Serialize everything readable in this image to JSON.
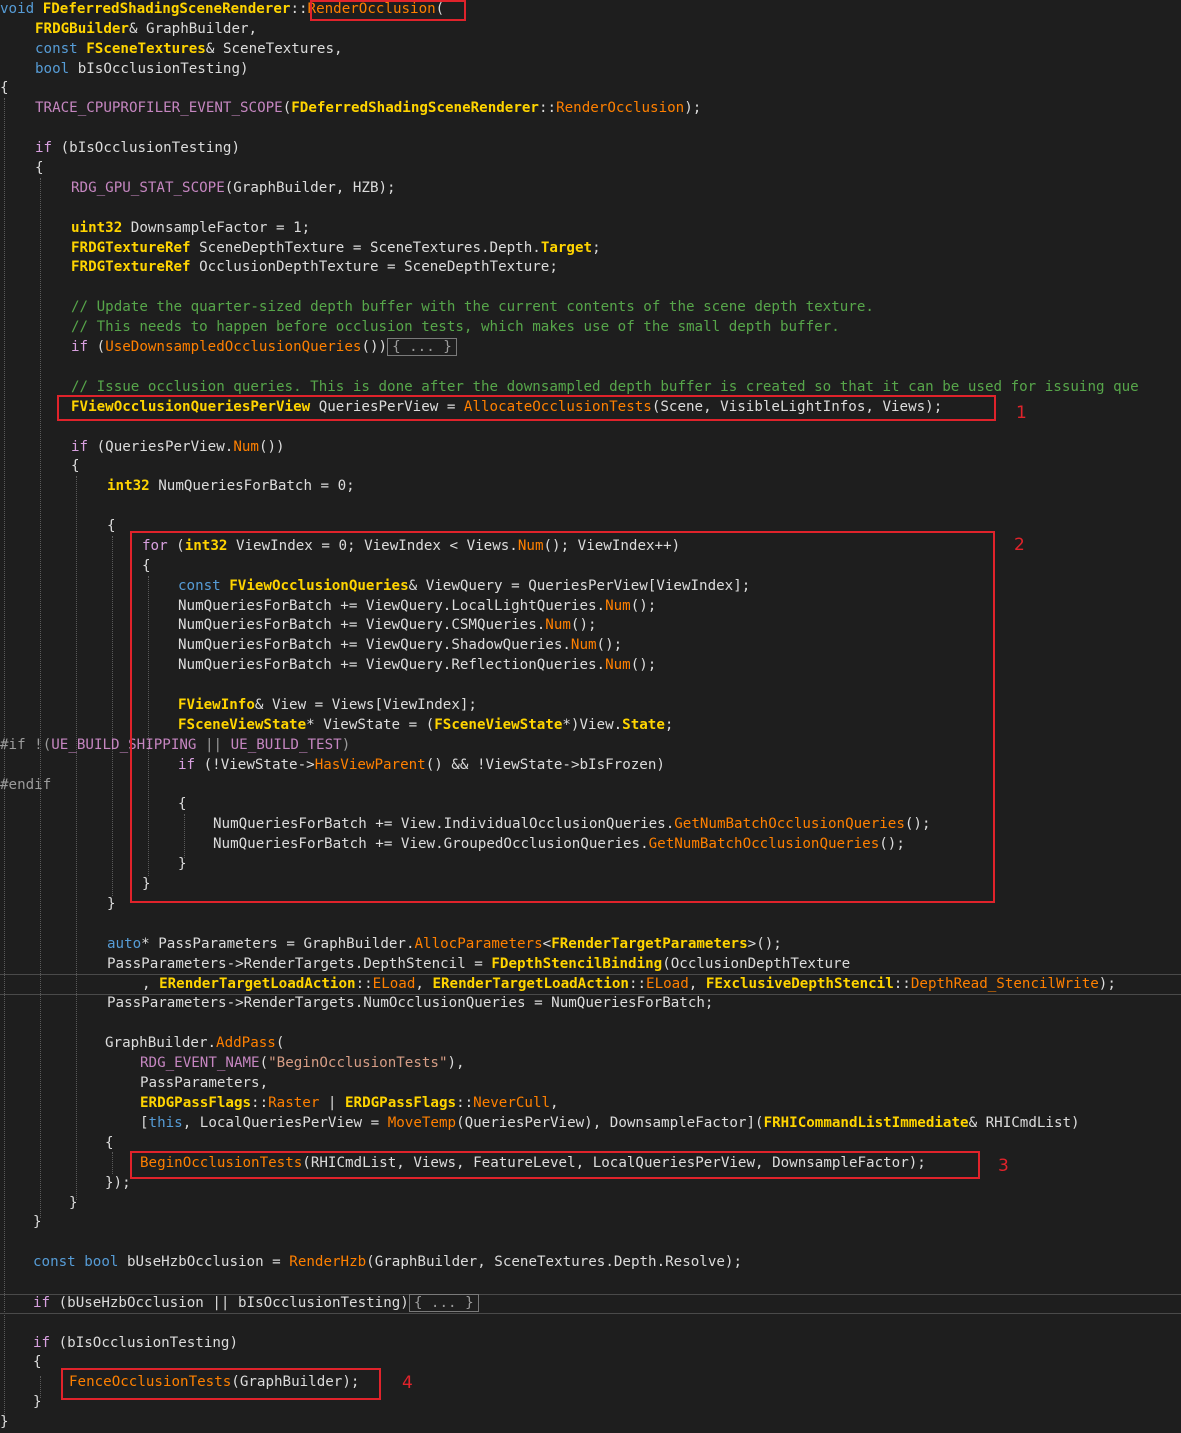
{
  "code": {
    "sig_void": "void",
    "sig_class": "FDeferredShadingSceneRenderer",
    "sig_sep": "::",
    "sig_fn": "RenderOcclusion",
    "sig_paren": "(",
    "p1_type": "FRDGBuilder",
    "p1_rest": "& GraphBuilder,",
    "p2_const": "const",
    "p2_type": "FSceneTextures",
    "p2_rest": "& SceneTextures,",
    "p3_bool": "bool",
    "p3_rest": " bIsOcclusionTesting)",
    "brace_open": "{",
    "trace_macro": "TRACE_CPUPROFILER_EVENT_SCOPE",
    "trace_open": "(",
    "trace_class": "FDeferredShadingSceneRenderer",
    "trace_sep": "::",
    "trace_fn": "RenderOcclusion",
    "trace_close": ");",
    "if1_kw": "if",
    "if1_rest": " (bIsOcclusionTesting)",
    "gpu_macro": "RDG_GPU_STAT_SCOPE",
    "gpu_rest": "(GraphBuilder, HZB);",
    "ds_type": "uint32",
    "ds_rest": " DownsampleFactor = 1;",
    "sdt_type": "FRDGTextureRef",
    "sdt_a": " SceneDepthTexture = SceneTextures.Depth.",
    "sdt_target": "Target",
    "sdt_end": ";",
    "odt_type": "FRDGTextureRef",
    "odt_rest": " OcclusionDepthTexture = SceneDepthTexture;",
    "comment1": "// Update the quarter-sized depth buffer with the current contents of the scene depth texture.",
    "comment2": "// This needs to happen before occlusion tests, which makes use of the small depth buffer.",
    "if2_kw": "if",
    "if2_a": " (",
    "if2_fn": "UseDownsampledOcclusionQueries",
    "if2_b": "())",
    "fold1": "{ ... }",
    "comment3": "// Issue occlusion queries. This is done after the downsampled depth buffer is created so that it can be used for issuing que",
    "qpv_type": "FViewOcclusionQueriesPerView",
    "qpv_a": " QueriesPerView = ",
    "qpv_fn": "AllocateOcclusionTests",
    "qpv_b": "(Scene, VisibleLightInfos, Views);",
    "if3_kw": "if",
    "if3_a": " (QueriesPerView.",
    "if3_num": "Num",
    "if3_b": "())",
    "nq_type": "int32",
    "nq_rest": " NumQueriesForBatch = 0;",
    "for_kw": "for",
    "for_a": " (",
    "for_type": "int32",
    "for_b": " ViewIndex = 0; ViewIndex < Views.",
    "for_num": "Num",
    "for_c": "(); ViewIndex++)",
    "vq_const": "const",
    "vq_type": "FViewOcclusionQueries",
    "vq_rest": "& ViewQuery = QueriesPerView[ViewIndex];",
    "l1_a": "NumQueriesForBatch += ViewQuery.LocalLightQueries.",
    "l2_a": "NumQueriesForBatch += ViewQuery.CSMQueries.",
    "l3_a": "NumQueriesForBatch += ViewQuery.ShadowQueries.",
    "l4_a": "NumQueriesForBatch += ViewQuery.ReflectionQueries.",
    "num_fn": "Num",
    "num_end": "();",
    "vi_type": "FViewInfo",
    "vi_rest": "& View = Views[ViewIndex];",
    "vs_type": "FSceneViewState",
    "vs_a": "* ViewState = (",
    "vs_type2": "FSceneViewState",
    "vs_b": "*)View.",
    "vs_state": "State",
    "vs_end": ";",
    "pp_if": "#if !(",
    "pp_m1": "UE_BUILD_SHIPPING",
    "pp_or": " || ",
    "pp_m2": "UE_BUILD_TEST",
    "pp_close": ")",
    "if4_kw": "if",
    "if4_a": " (!ViewState->",
    "if4_fn": "HasViewParent",
    "if4_b": "() && !ViewState->bIsFrozen)",
    "pp_endif": "#endif",
    "gn1_a": "NumQueriesForBatch += View.IndividualOcclusionQueries.",
    "gn2_a": "NumQueriesForBatch += View.GroupedOcclusionQueries.",
    "gn_fn": "GetNumBatchOcclusionQueries",
    "gn_end": "();",
    "brace_close": "}",
    "pp1_auto": "auto",
    "pp1_a": "* PassParameters = GraphBuilder.",
    "pp1_fn": "AllocParameters",
    "pp1_b": "<",
    "pp1_type": "FRenderTargetParameters",
    "pp1_c": ">();",
    "pp2_a": "PassParameters->RenderTargets.DepthStencil = ",
    "pp2_type": "FDepthStencilBinding",
    "pp2_b": "(OcclusionDepthTexture",
    "pp3_a": ", ",
    "pp3_t1": "ERenderTargetLoadAction",
    "pp3_sep": "::",
    "pp3_e1": "ELoad",
    "pp3_b": ", ",
    "pp3_t2": "ERenderTargetLoadAction",
    "pp3_e2": "ELoad",
    "pp3_c": ", ",
    "pp3_t3": "FExclusiveDepthStencil",
    "pp3_e3": "DepthRead_StencilWrite",
    "pp3_end": ");",
    "pp4": "PassParameters->RenderTargets.NumOcclusionQueries = NumQueriesForBatch;",
    "ap_a": "GraphBuilder.",
    "ap_fn": "AddPass",
    "ap_b": "(",
    "ev_macro": "RDG_EVENT_NAME",
    "ev_a": "(",
    "ev_str": "\"BeginOcclusionTests\"",
    "ev_b": "),",
    "pass_params": "PassParameters,",
    "fl_t1": "ERDGPassFlags",
    "fl_sep": "::",
    "fl_e1": "Raster",
    "fl_or": " | ",
    "fl_t2": "ERDGPassFlags",
    "fl_e2": "NeverCull",
    "fl_end": ",",
    "lam_a": "[",
    "lam_this": "this",
    "lam_b": ", LocalQueriesPerView = ",
    "lam_fn": "MoveTemp",
    "lam_c": "(QueriesPerView), DownsampleFactor](",
    "lam_type": "FRHICommandListImmediate",
    "lam_d": "& RHICmdList)",
    "bot_fn": "BeginOcclusionTests",
    "bot_rest": "(RHICmdList, Views, FeatureLevel, LocalQueriesPerView, DownsampleFactor);",
    "close_lambda": "});",
    "hzb_const": "const",
    "hzb_bool": "bool",
    "hzb_a": " bUseHzbOcclusion = ",
    "hzb_fn": "RenderHzb",
    "hzb_b": "(GraphBuilder, SceneTextures.Depth.Resolve);",
    "if5_kw": "if",
    "if5_a": " (bUseHzbOcclusion || bIsOcclusionTesting)",
    "fold2": "{ ... }",
    "if6_kw": "if",
    "if6_a": " (bIsOcclusionTesting)",
    "fot_fn": "FenceOcclusionTests",
    "fot_rest": "(GraphBuilder);"
  },
  "annotations": [
    "1",
    "2",
    "3",
    "4"
  ],
  "colors": {
    "background": "#1e1e1e",
    "keyword": "#569cd6",
    "type": "#ffd400",
    "function": "#ff8000",
    "macro": "#c586c0",
    "comment": "#57a64a",
    "highlight_box": "#e0232b"
  }
}
